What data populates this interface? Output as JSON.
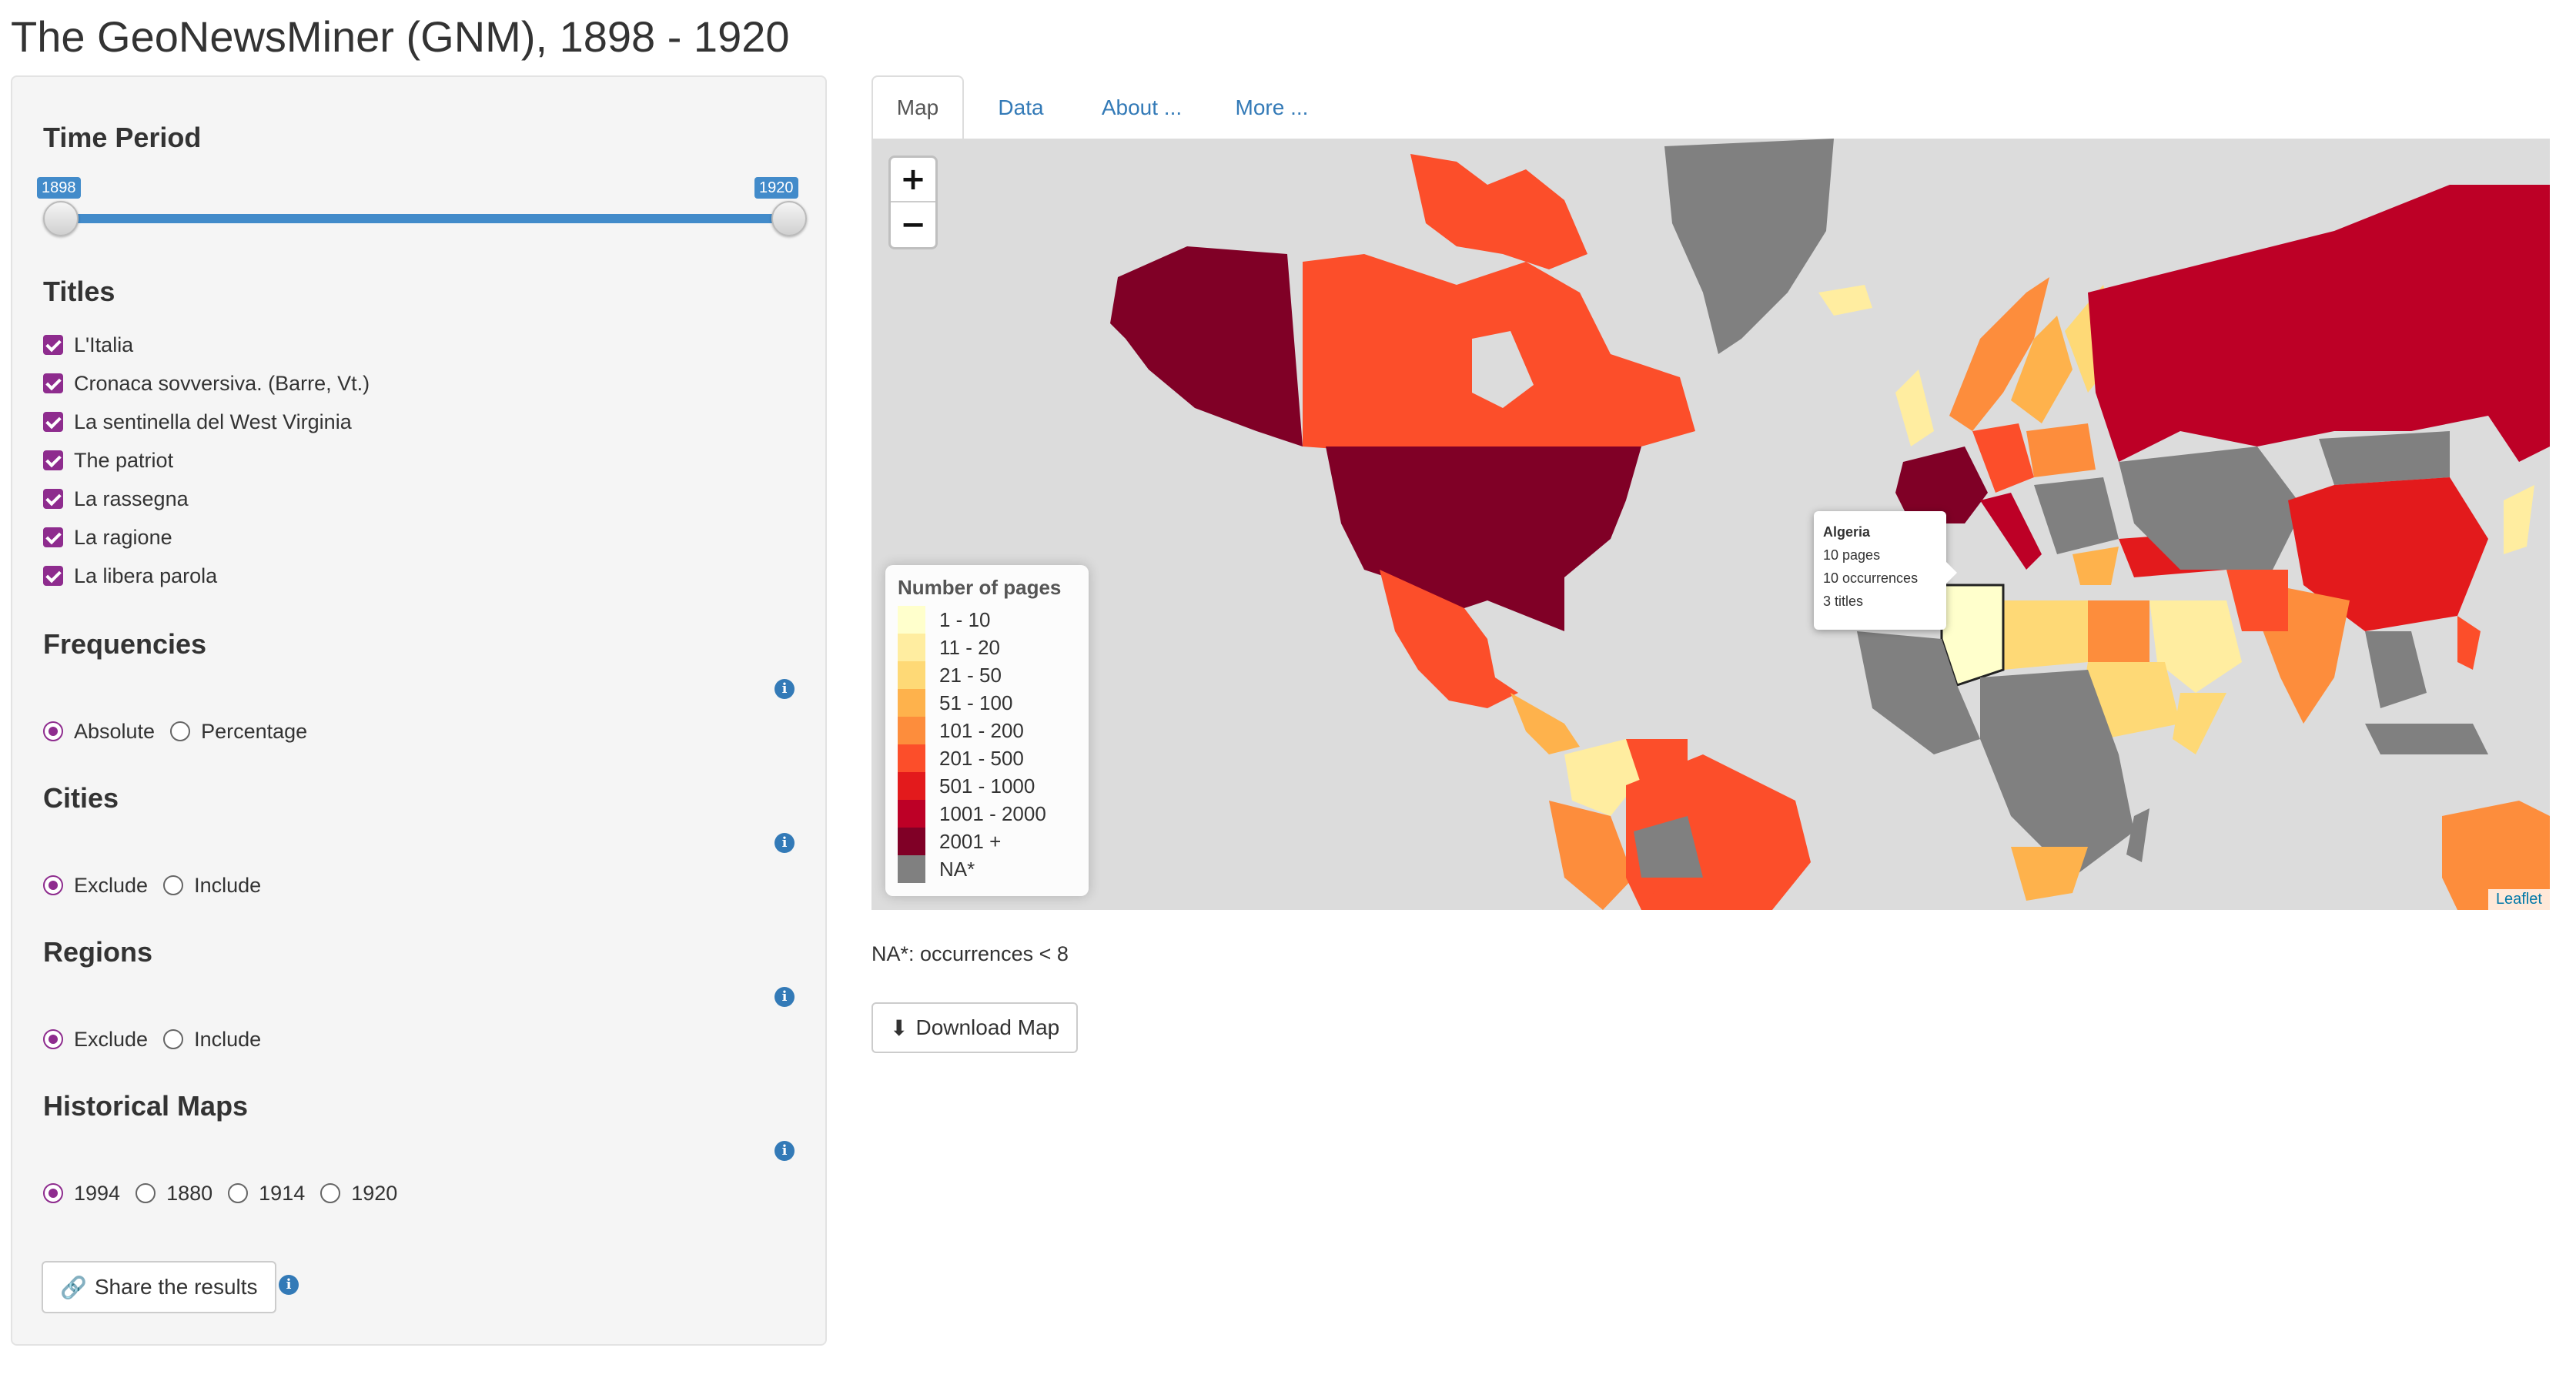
{
  "header": {
    "title": "The GeoNewsMiner (GNM), 1898 - 1920"
  },
  "sidebar": {
    "time_period": {
      "label": "Time Period",
      "min_label": "1898",
      "max_label": "1920"
    },
    "titles": {
      "label": "Titles",
      "items": [
        "L'Italia",
        "Cronaca sovversiva. (Barre, Vt.)",
        "La sentinella del West Virginia",
        "The patriot",
        "La rassegna",
        "La ragione",
        "La libera parola"
      ]
    },
    "frequencies": {
      "label": "Frequencies",
      "options": [
        "Absolute",
        "Percentage"
      ],
      "selected": "Absolute"
    },
    "cities": {
      "label": "Cities",
      "options": [
        "Exclude",
        "Include"
      ],
      "selected": "Exclude"
    },
    "regions": {
      "label": "Regions",
      "options": [
        "Exclude",
        "Include"
      ],
      "selected": "Exclude"
    },
    "historical_maps": {
      "label": "Historical Maps",
      "options": [
        "1994",
        "1880",
        "1914",
        "1920"
      ],
      "selected": "1994"
    },
    "share_button": "Share the results",
    "info_glyph": "i"
  },
  "tabs": [
    {
      "label": "Map",
      "active": true
    },
    {
      "label": "Data",
      "active": false
    },
    {
      "label": "About ...",
      "active": false
    },
    {
      "label": "More ...",
      "active": false
    }
  ],
  "map": {
    "zoom_in": "+",
    "zoom_out": "−",
    "attribution": "Leaflet",
    "legend": {
      "title": "Number of pages",
      "items": [
        {
          "label": "1 - 10",
          "color": "#ffffcc"
        },
        {
          "label": "11 - 20",
          "color": "#ffeda0"
        },
        {
          "label": "21 - 50",
          "color": "#fed976"
        },
        {
          "label": "51 - 100",
          "color": "#feb24c"
        },
        {
          "label": "101 - 200",
          "color": "#fd8d3c"
        },
        {
          "label": "201 - 500",
          "color": "#fc4e2a"
        },
        {
          "label": "501 - 1000",
          "color": "#e31a1c"
        },
        {
          "label": "1001 - 2000",
          "color": "#bd0026"
        },
        {
          "label": "2001 +",
          "color": "#800026"
        },
        {
          "label": "NA*",
          "color": "#808080"
        }
      ]
    },
    "popup": {
      "country": "Algeria",
      "pages": "10 pages",
      "occurrences": "10 occurrences",
      "titles": "3 titles"
    }
  },
  "na_note": "NA*: occurrences < 8",
  "download_button": "Download Map",
  "colors": {
    "accent": "#8e2c8e",
    "link": "#337ab7",
    "slider": "#428bca"
  }
}
